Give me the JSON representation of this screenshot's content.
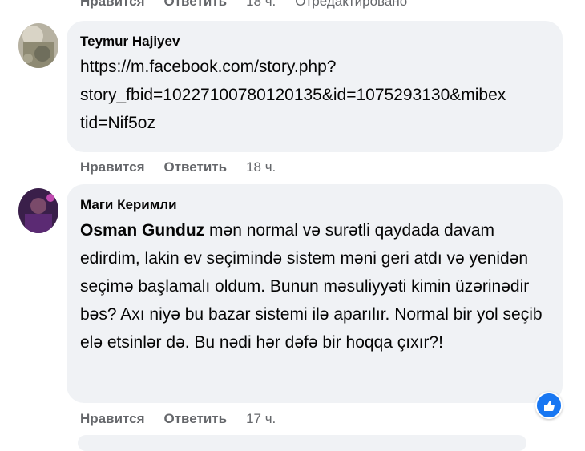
{
  "top_actions": {
    "like": "Нравится",
    "reply": "Ответить",
    "time": "18 ч.",
    "edited": "Отредактировано"
  },
  "comments": [
    {
      "author": "Teymur Hajiyev",
      "text": "https://m.facebook.com/story.php?\nstory_fbid=10227100780120135&id=1075293130&mibex\ntid=Nif5oz",
      "actions": {
        "like": "Нравится",
        "reply": "Ответить",
        "time": "18 ч."
      }
    },
    {
      "author": "Маги Керимли",
      "mention": "Osman Gunduz",
      "text": "mən normal və surətli qaydada davam edirdim, lakin ev seçimində sistem məni geri atdı və yenidən seçimə başlamalı oldum. Bunun məsuliyyəti kimin üzərinədir bəs? Axı niyə bu bazar sistemi ilə aparılır. Normal bir yol seçib elə etsinlər də. Bu nədi hər dəfə bir hoqqa çıxır?!",
      "actions": {
        "like": "Нравится",
        "reply": "Ответить",
        "time": "17 ч."
      },
      "reaction": "like-icon"
    }
  ]
}
